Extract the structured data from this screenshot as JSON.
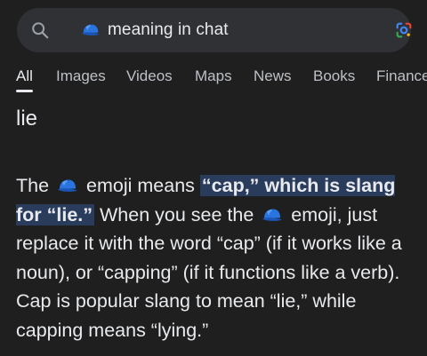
{
  "search": {
    "emoji_icon": "billed-cap-emoji",
    "query_text": "meaning in chat"
  },
  "tabs": [
    {
      "label": "All",
      "active": true
    },
    {
      "label": "Images"
    },
    {
      "label": "Videos"
    },
    {
      "label": "Maps"
    },
    {
      "label": "News"
    },
    {
      "label": "Books"
    },
    {
      "label": "Finance"
    }
  ],
  "result": {
    "title": "lie",
    "snippet": {
      "t1": "The",
      "t2": "emoji means",
      "highlight": "“cap,” which is slang for “lie.”",
      "t3": "When you see the",
      "t4": "emoji, just replace it with the word “cap” (if it works like a noun), or “capping” (if it functions like a verb). Cap is popular slang to mean “lie,” while capping means “lying.”"
    }
  },
  "colors": {
    "background": "#1f1f1f",
    "searchbar": "#303134",
    "highlight": "#2a3c5c",
    "cap_blue": "#1a73e8"
  }
}
